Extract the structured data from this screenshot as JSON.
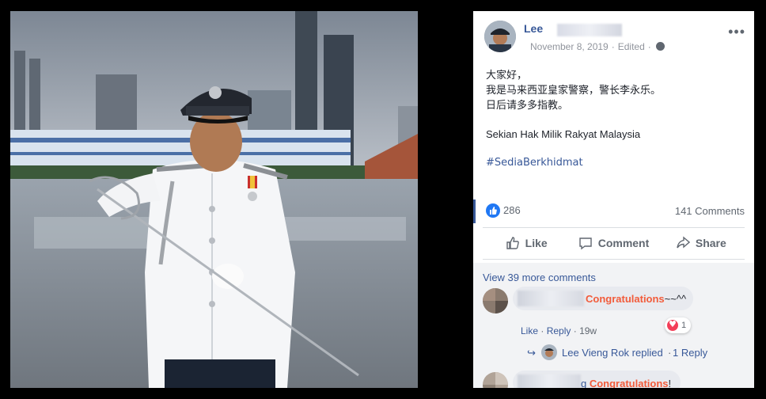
{
  "post": {
    "author_name": "Lee",
    "date": "November 8, 2019",
    "edited": "Edited",
    "more_label": "•••",
    "body_lines": [
      "大家好，",
      "我是马来西亚皇家警察，警长李永乐。",
      "日后请多多指教。"
    ],
    "body_line_2": "Sekian Hak Milik Rakyat Malaysia",
    "hashtag": "#SediaBerkhidmat"
  },
  "reactions": {
    "like_count": "286",
    "comment_count": "141 Comments"
  },
  "actions": {
    "like": "Like",
    "comment": "Comment",
    "share": "Share"
  },
  "comments": {
    "view_more": "View 39 more comments",
    "first": {
      "highlight": "Congratulations",
      "suffix": "~~^^",
      "like_label": "Like",
      "reply_label": "Reply",
      "time": "19w",
      "reaction_count": "1",
      "reply_author": "Lee Vieng Rok replied",
      "reply_count": "1 Reply"
    },
    "second": {
      "prefix": "g ",
      "highlight": "Congratulations",
      "suffix": "!"
    }
  },
  "colors": {
    "link_blue": "#385898",
    "facebook_blue": "#2078f4",
    "highlight_orange": "#f25b3a",
    "heart_red": "#f33e58"
  }
}
